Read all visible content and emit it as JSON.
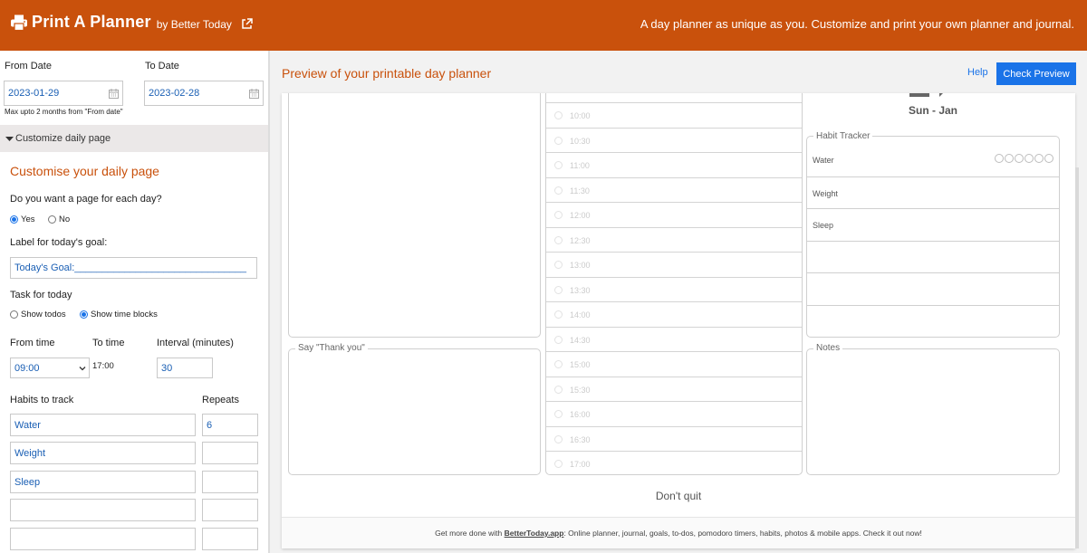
{
  "header": {
    "brand": "Print A Planner",
    "by": "by Better Today",
    "tagline": "A day planner as unique as you. Customize and print your own planner and journal.",
    "icons": {
      "printer": "printer-icon",
      "external": "external-link-icon"
    },
    "bg_color": "#c9510c"
  },
  "dates": {
    "from_label": "From Date",
    "from_value": "2023-01-29",
    "to_label": "To Date",
    "to_value": "2023-02-28",
    "hint": "Max upto 2 months from \"From date\""
  },
  "customize_bar": {
    "label": "Customize daily page"
  },
  "customise": {
    "title": "Customise your daily page",
    "page_each_day_q": "Do you want a page for each day?",
    "yes": "Yes",
    "no": "No",
    "goal_label": "Label for today's goal:",
    "goal_value": "Today's Goal:_______________________________",
    "task_label": "Task for today",
    "show_todos": "Show todos",
    "show_time_blocks": "Show time blocks",
    "from_time_label": "From time",
    "from_time_value": "09:00",
    "to_time_label": "To time",
    "to_time_value": "17:00",
    "interval_label": "Interval (minutes)",
    "interval_value": "30",
    "habits_label": "Habits to track",
    "repeats_label": "Repeats",
    "habits": [
      {
        "name": "Water",
        "repeats": "6"
      },
      {
        "name": "Weight",
        "repeats": ""
      },
      {
        "name": "Sleep",
        "repeats": ""
      },
      {
        "name": "",
        "repeats": ""
      },
      {
        "name": "",
        "repeats": ""
      }
    ]
  },
  "main": {
    "title": "Preview of your printable day planner",
    "help": "Help",
    "check_preview": "Check Preview"
  },
  "preview": {
    "date_head": "Sun - Jan",
    "say_thank_you": "Say \"Thank you\"",
    "habit_tracker": "Habit Tracker",
    "notes": "Notes",
    "times": [
      "10:00",
      "10:30",
      "11:00",
      "11:30",
      "12:00",
      "12:30",
      "13:00",
      "13:30",
      "14:00",
      "14:30",
      "15:00",
      "15:30",
      "16:00",
      "16:30",
      "17:00"
    ],
    "habit_rows": [
      "Water",
      "Weight",
      "Sleep",
      "",
      "",
      ""
    ],
    "habit_circle_count": 6,
    "quote": "Don't quit",
    "footer_prefix": "Get more done with ",
    "footer_link": "BetterToday.app",
    "footer_suffix": ": Online planner, journal, goals, to-dos, pomodoro timers, habits, photos & mobile apps. Check it out now!"
  }
}
